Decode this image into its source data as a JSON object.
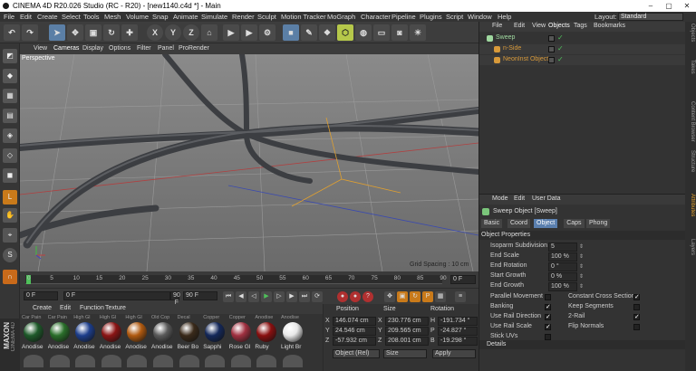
{
  "app": {
    "title": "CINEMA 4D R20.026 Studio (RC - R20) - [new1140.c4d *] - Main",
    "layout_label": "Layout:",
    "layout_value": "Standard"
  },
  "menu": [
    "File",
    "Edit",
    "Create",
    "Select",
    "Tools",
    "Mesh",
    "Volume",
    "Snap",
    "Animate",
    "Simulate",
    "Render",
    "Sculpt",
    "Motion Tracker",
    "MoGraph",
    "Character",
    "Pipeline",
    "Plugins",
    "Script",
    "Window",
    "Help"
  ],
  "toolbar": {
    "x": "X",
    "y": "Y",
    "z": "Z"
  },
  "viewport": {
    "menu": [
      "View",
      "Cameras",
      "Display",
      "Options",
      "Filter",
      "Panel",
      "ProRender"
    ],
    "name": "Perspective",
    "grid_spacing": "Grid Spacing : 10 cm"
  },
  "timeline": {
    "ticks": [
      "0",
      "5",
      "10",
      "15",
      "20",
      "25",
      "30",
      "35",
      "40",
      "45",
      "50",
      "55",
      "60",
      "65",
      "70",
      "75",
      "80",
      "85",
      "90"
    ],
    "current_frame": "0 F"
  },
  "transport": {
    "start": "0 F",
    "min": "0 F",
    "max": "90 F",
    "end": "90 F"
  },
  "materials": {
    "menu": [
      "Create",
      "Edit",
      "Function",
      "Texture"
    ],
    "top_labels": [
      "Car Pain",
      "Car Pain",
      "High Gl",
      "High Gl",
      "High Gl",
      "Old Cop",
      "Decal",
      "Copper",
      "Copper",
      "Anodise",
      "Anodise"
    ],
    "names": [
      "Anodise",
      "Anodise",
      "Anodise",
      "Anodise",
      "Anodise",
      "Anodise",
      "Beer Bo",
      "Sapphi",
      "Rose Gl",
      "Ruby",
      "Light Br"
    ],
    "colors": [
      "#1e5a2a",
      "#2a6e2a",
      "#1d3e8c",
      "#8a1414",
      "#b05a10",
      "#5a5a5a",
      "#3a2a1a",
      "#14285a",
      "#a03040",
      "#8a1010",
      "#e8e8e8"
    ]
  },
  "coords": {
    "headers": [
      "Position",
      "Size",
      "Rotation"
    ],
    "rows": [
      {
        "axis": "X",
        "pos": "146.074 cm",
        "sax": "X",
        "size": "230.776 cm",
        "rax": "H",
        "rot": "-191.734 °"
      },
      {
        "axis": "Y",
        "pos": "24.546 cm",
        "sax": "Y",
        "size": "209.565 cm",
        "rax": "P",
        "rot": "-24.827 °"
      },
      {
        "axis": "Z",
        "pos": "-57.932 cm",
        "sax": "Z",
        "size": "208.001 cm",
        "rax": "B",
        "rot": "-19.298 °"
      }
    ],
    "mode": "Object (Rel)",
    "size_mode": "Size",
    "apply": "Apply"
  },
  "objects": {
    "menu": [
      "File",
      "Edit",
      "View",
      "Objects",
      "Tags",
      "Bookmarks"
    ],
    "items": [
      {
        "name": "Sweep",
        "color": "#9fd89f"
      },
      {
        "name": "n-Side",
        "color": "#d89a3a"
      },
      {
        "name": "NeonInst Object",
        "color": "#d89a3a"
      }
    ]
  },
  "attributes": {
    "menu": [
      "Mode",
      "Edit",
      "User Data"
    ],
    "object_title": "Sweep Object [Sweep]",
    "tabs": [
      "Basic",
      "Coord",
      "Object",
      "Caps",
      "Phong"
    ],
    "active_tab": "Object",
    "section": "Object Properties",
    "fields": [
      {
        "label": "Isoparm Subdivision",
        "value": "5"
      },
      {
        "label": "End Scale",
        "value": "100 %"
      },
      {
        "label": "End Rotation",
        "value": "0 °"
      },
      {
        "label": "Start Growth",
        "value": "0 %"
      },
      {
        "label": "End Growth",
        "value": "100 %"
      }
    ],
    "checks_left": [
      {
        "label": "Parallel Movement",
        "checked": false
      },
      {
        "label": "Banking",
        "checked": true
      },
      {
        "label": "Use Rail Direction",
        "checked": true
      },
      {
        "label": "Use Rail Scale",
        "checked": true
      },
      {
        "label": "Stick UVs",
        "checked": false
      }
    ],
    "checks_right": [
      {
        "label": "Constant Cross Section",
        "checked": true
      },
      {
        "label": "Keep Segments",
        "checked": false
      },
      {
        "label": "2-Rail",
        "checked": true
      },
      {
        "label": "Flip Normals",
        "checked": false
      }
    ],
    "details": "Details"
  },
  "right_tabs": [
    "Objects",
    "Takes",
    "Content Browser",
    "Structure",
    "Attributes",
    "Layers"
  ],
  "brand": {
    "line1": "MAXON",
    "line2": "CINEMA 4D"
  }
}
